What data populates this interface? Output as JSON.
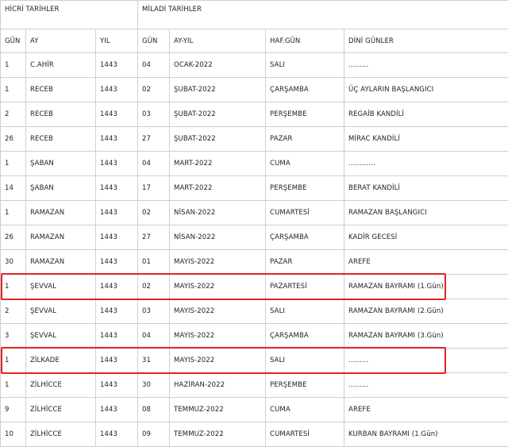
{
  "groups": {
    "hijri": "HİCRİ TARİHLER",
    "gregorian": "MİLADİ TARİHLER"
  },
  "columns": [
    "GÜN",
    "AY",
    "YIL",
    "GÜN",
    "AY-YIL",
    "HAF.GÜN",
    "DİNİ GÜNLER"
  ],
  "rows": [
    [
      "1",
      "C.AHİR",
      "1443",
      "04",
      "OCAK-2022",
      "SALI",
      "........."
    ],
    [
      "1",
      "RECEB",
      "1443",
      "02",
      "ŞUBAT-2022",
      "ÇARŞAMBA",
      "ÜÇ AYLARIN BAŞLANGICI"
    ],
    [
      "2",
      "RECEB",
      "1443",
      "03",
      "ŞUBAT-2022",
      "PERŞEMBE",
      "REGAİB KANDİLİ"
    ],
    [
      "26",
      "RECEB",
      "1443",
      "27",
      "ŞUBAT-2022",
      "PAZAR",
      "MİRAC KANDİLİ"
    ],
    [
      "1",
      "ŞABAN",
      "1443",
      "04",
      "MART-2022",
      "CUMA",
      "............"
    ],
    [
      "14",
      "ŞABAN",
      "1443",
      "17",
      "MART-2022",
      "PERŞEMBE",
      "BERAT KANDİLİ"
    ],
    [
      "1",
      "RAMAZAN",
      "1443",
      "02",
      "NİSAN-2022",
      "CUMARTESİ",
      "RAMAZAN BAŞLANGICI"
    ],
    [
      "26",
      "RAMAZAN",
      "1443",
      "27",
      "NİSAN-2022",
      "ÇARŞAMBA",
      "KADİR GECESİ"
    ],
    [
      "30",
      "RAMAZAN",
      "1443",
      "01",
      "MAYIS-2022",
      "PAZAR",
      "AREFE"
    ],
    [
      "1",
      "ŞEVVAL",
      "1443",
      "02",
      "MAYIS-2022",
      "PAZARTESİ",
      "RAMAZAN BAYRAMI (1.Gün)"
    ],
    [
      "2",
      "ŞEVVAL",
      "1443",
      "03",
      "MAYIS-2022",
      "SALI",
      "RAMAZAN BAYRAMI (2.Gün)"
    ],
    [
      "3",
      "ŞEVVAL",
      "1443",
      "04",
      "MAYIS-2022",
      "ÇARŞAMBA",
      "RAMAZAN BAYRAMI (3.Gün)"
    ],
    [
      "1",
      "ZİLKADE",
      "1443",
      "31",
      "MAYIS-2022",
      "SALI",
      "........."
    ],
    [
      "1",
      "ZİLHİCCE",
      "1443",
      "30",
      "HAZİRAN-2022",
      "PERŞEMBE",
      "........."
    ],
    [
      "9",
      "ZİLHİCCE",
      "1443",
      "08",
      "TEMMUZ-2022",
      "CUMA",
      "AREFE"
    ],
    [
      "10",
      "ZİLHİCCE",
      "1443",
      "09",
      "TEMMUZ-2022",
      "CUMARTESİ",
      "KURBAN BAYRAMI (1.Gün)"
    ]
  ],
  "highlight_color": "#e02424",
  "highlighted_rows": [
    9,
    12
  ]
}
